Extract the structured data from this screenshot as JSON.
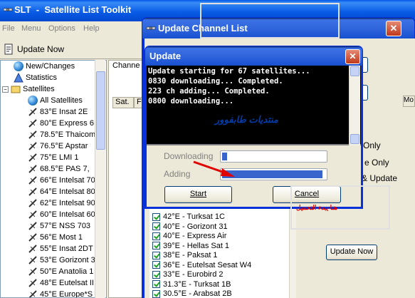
{
  "main_window": {
    "title": "SLT  -  Satellite List Toolkit",
    "menu": [
      "File",
      "Menu",
      "Options",
      "Help"
    ],
    "toolbar": {
      "update_now_label": "Update Now"
    },
    "tree": [
      {
        "label": "New/Changes",
        "icon": "globe-icon"
      },
      {
        "label": "Statistics",
        "icon": "statistics-icon"
      },
      {
        "label": "Satellites",
        "icon": "satellite-folder-icon"
      },
      {
        "label": "All Satellites",
        "icon": "globe-icon"
      },
      {
        "label": "83°E  Insat 2E",
        "icon": "satellite-icon"
      },
      {
        "label": "80°E  Express 6",
        "icon": "satellite-icon"
      },
      {
        "label": "78.5°E  Thaicom",
        "icon": "satellite-icon"
      },
      {
        "label": "76.5°E  Apstar",
        "icon": "satellite-icon"
      },
      {
        "label": "75°E  LMI 1",
        "icon": "satellite-icon"
      },
      {
        "label": "68.5°E  PAS 7,",
        "icon": "satellite-icon"
      },
      {
        "label": "66°E  Intelsat 70",
        "icon": "satellite-icon"
      },
      {
        "label": "64°E  Intelsat 80",
        "icon": "satellite-icon"
      },
      {
        "label": "62°E  Intelsat 90",
        "icon": "satellite-icon"
      },
      {
        "label": "60°E  Intelsat 60",
        "icon": "satellite-icon"
      },
      {
        "label": "57°E  NSS 703",
        "icon": "satellite-icon"
      },
      {
        "label": "56°E  Most 1",
        "icon": "satellite-icon"
      },
      {
        "label": "55°E  Insat 2DT",
        "icon": "satellite-icon"
      },
      {
        "label": "53°E  Gorizont 3",
        "icon": "satellite-icon"
      },
      {
        "label": "50°E  Anatolia 1",
        "icon": "satellite-icon"
      },
      {
        "label": "48°E  Eutelsat II",
        "icon": "satellite-icon"
      },
      {
        "label": "45°E  Europe*S",
        "icon": "satellite-icon"
      }
    ],
    "channel_header": "Channe",
    "columns": [
      "Sat.",
      "Fr"
    ],
    "right_column": "Mo"
  },
  "update_channel_dialog": {
    "title": "Update Channel List",
    "satellites": [
      "42°E - Turksat 1C",
      "40°E - Gorizont 31",
      "40°E - Express Air",
      "39°E - Hellas Sat 1",
      "38°E - Paksat 1",
      "36°E - Eutelsat Sesat W4",
      "33°E - Eurobird 2",
      "31.3°E - Turksat 1B",
      "30.5°E - Arabsat 2B"
    ],
    "options": [
      "Only",
      "e Only",
      "& Update"
    ],
    "update_now_label": "Update Now"
  },
  "update_dialog": {
    "title": "Update",
    "log_lines": [
      "Update starting for 67 satellites...",
      "0830 downloading... Completed.",
      "223 ch adding... Completed.",
      "0800 downloading..."
    ],
    "watermark": "منتديات  طابفوور",
    "downloading_label": "Downloading",
    "downloading_progress": 0.05,
    "adding_label": "Adding",
    "adding_progress": 0.97,
    "start_label": "Start",
    "cancel_label": "Cancel"
  },
  "annotation": {
    "text": "هنا يبدء التحميل",
    "arrow_color": "#e00000"
  }
}
